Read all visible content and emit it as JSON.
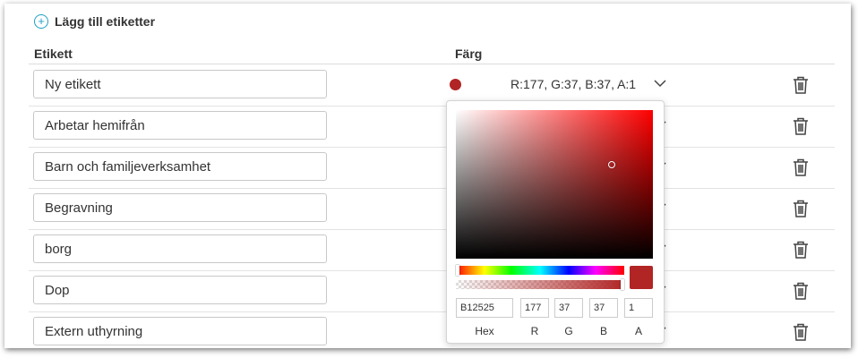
{
  "add_labels": "Lägg till etiketter",
  "header": {
    "label_col": "Etikett",
    "color_col": "Färg"
  },
  "rows": [
    {
      "name": "Ny etikett",
      "rgba": "R:177, G:37, B:37, A:1",
      "color": "#b12525"
    },
    {
      "name": "Arbetar hemifrån"
    },
    {
      "name": "Barn och familjeverksamhet"
    },
    {
      "name": "Begravning"
    },
    {
      "name": "borg"
    },
    {
      "name": "Dop"
    },
    {
      "name": "Extern uthyrning"
    }
  ],
  "picker": {
    "hex": "B12525",
    "r": "177",
    "g": "37",
    "b": "37",
    "a": "1",
    "labels": {
      "hex": "Hex",
      "r": "R",
      "g": "G",
      "b": "B",
      "a": "A"
    },
    "selected_color": "#b12525",
    "hue_color": "#ff0000"
  },
  "icons": {
    "add": "plus-circle-icon",
    "expand": "chevron-down-icon",
    "delete": "trash-icon"
  }
}
